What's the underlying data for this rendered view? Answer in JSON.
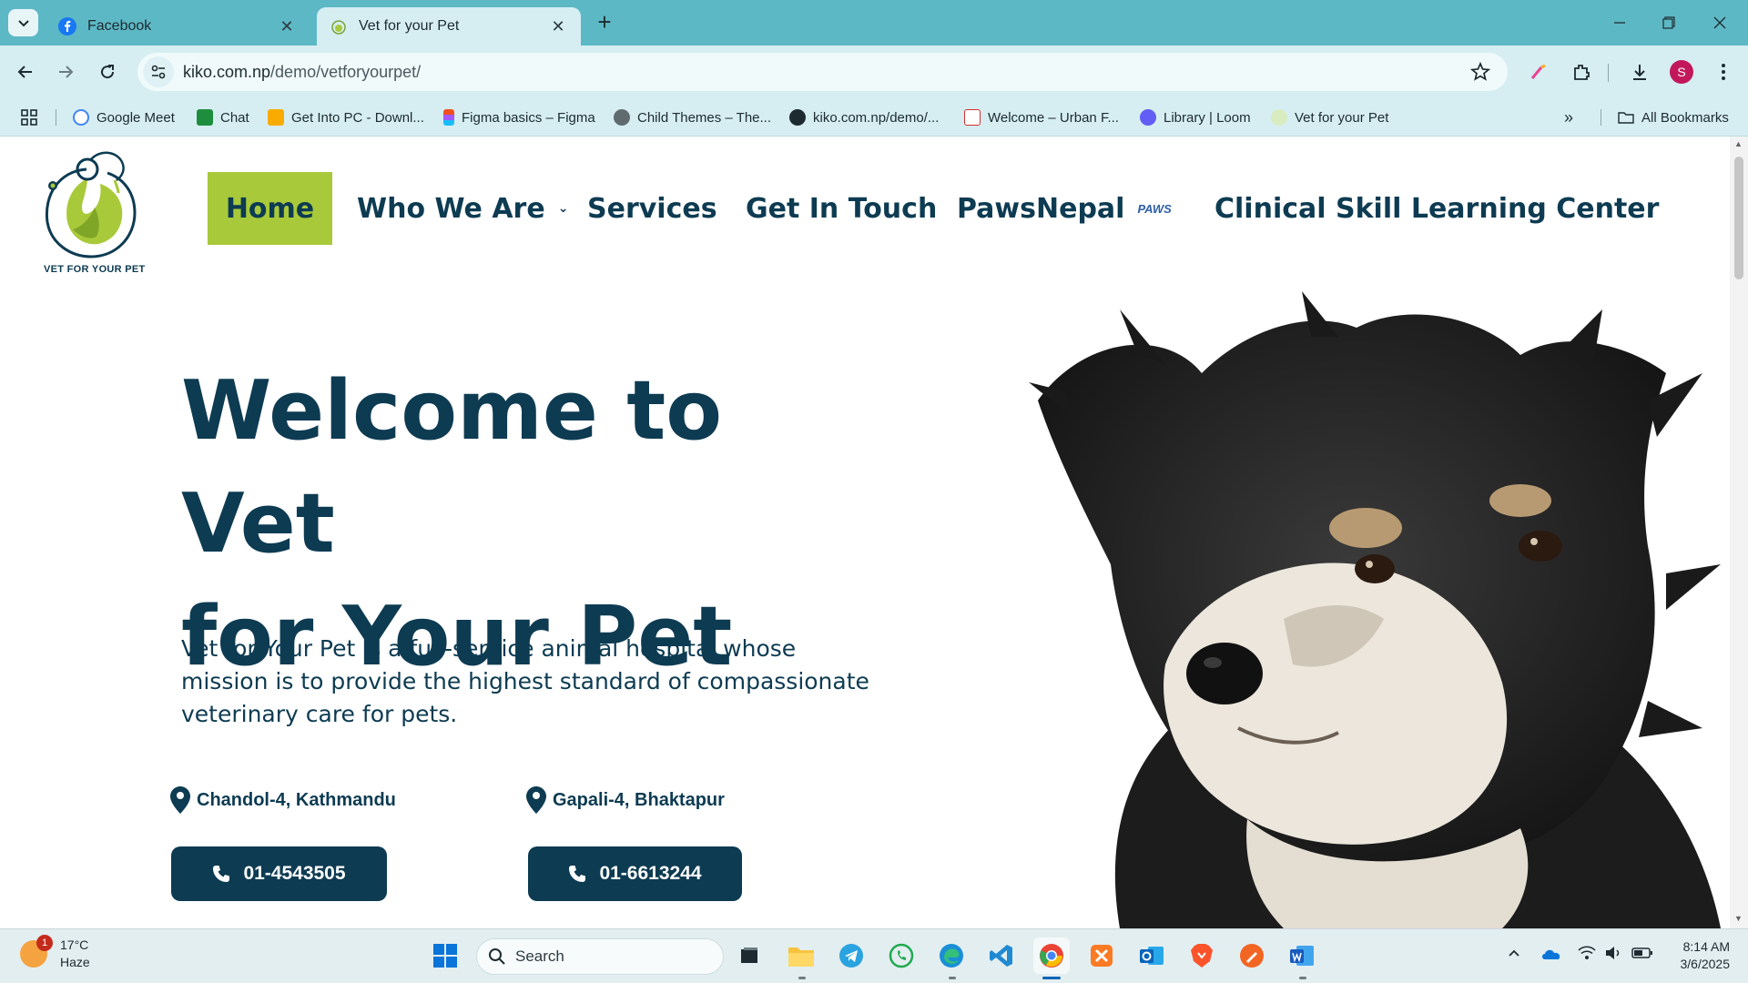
{
  "browser": {
    "tabs": [
      {
        "title": "Facebook",
        "active": false
      },
      {
        "title": "Vet for your Pet",
        "active": true
      }
    ],
    "url_host": "kiko.com.np",
    "url_path": "/demo/vetforyourpet/",
    "avatar_letter": "S",
    "bookmarks": [
      {
        "label": "Google Meet"
      },
      {
        "label": "Chat"
      },
      {
        "label": "Get Into PC - Downl..."
      },
      {
        "label": "Figma basics – Figma"
      },
      {
        "label": "Child Themes – The..."
      },
      {
        "label": "kiko.com.np/demo/..."
      },
      {
        "label": "Welcome – Urban F..."
      },
      {
        "label": "Library | Loom"
      },
      {
        "label": "Vet for your Pet"
      }
    ],
    "all_bookmarks": "All Bookmarks"
  },
  "site": {
    "logo_text": "VET FOR YOUR PET",
    "nav": {
      "home": "Home",
      "who_we_are": "Who We Are",
      "services": "Services",
      "get_in_touch": "Get In Touch",
      "paws_nepal": "PawsNepal",
      "paws_badge": "PAWS",
      "clinical": "Clinical Skill Learning Center"
    },
    "hero": {
      "title_line1": "Welcome to Vet",
      "title_line2": "for Your Pet",
      "description": "Vet for Your Pet is a full-service animal hospital whose mission is to provide the highest standard of compassionate veterinary care for pets."
    },
    "locations": [
      {
        "address": "Chandol-4, Kathmandu",
        "phone": "01-4543505"
      },
      {
        "address": "Gapali-4, Bhaktapur",
        "phone": "01-6613244"
      }
    ],
    "colors": {
      "primary": "#0d3b52",
      "accent": "#a8c93a"
    }
  },
  "taskbar": {
    "weather_temp": "17°C",
    "weather_cond": "Haze",
    "weather_badge": "1",
    "search_label": "Search",
    "time": "8:14 AM",
    "date": "3/6/2025"
  }
}
